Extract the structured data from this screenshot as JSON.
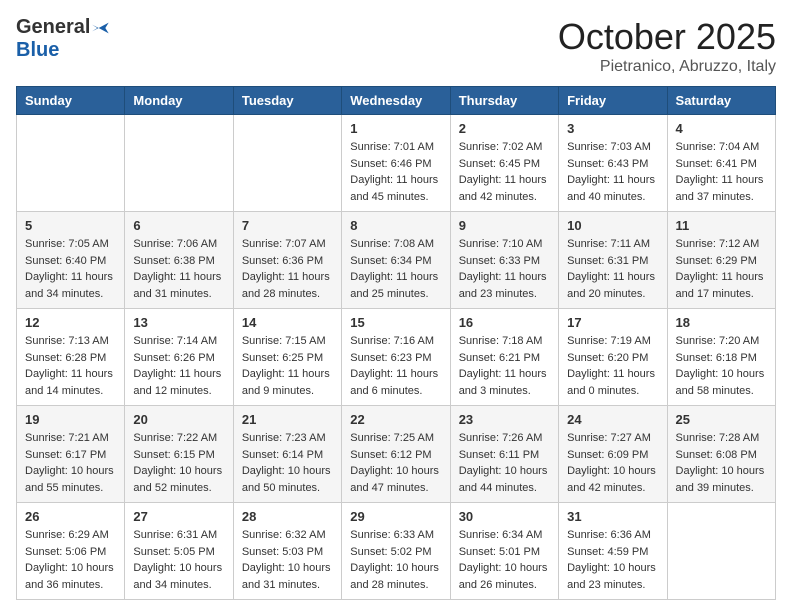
{
  "header": {
    "logo": {
      "general": "General",
      "blue": "Blue",
      "tagline": ""
    },
    "title": "October 2025",
    "location": "Pietranico, Abruzzo, Italy"
  },
  "weekdays": [
    "Sunday",
    "Monday",
    "Tuesday",
    "Wednesday",
    "Thursday",
    "Friday",
    "Saturday"
  ],
  "weeks": [
    [
      {
        "day": "",
        "sunrise": "",
        "sunset": "",
        "daylight": ""
      },
      {
        "day": "",
        "sunrise": "",
        "sunset": "",
        "daylight": ""
      },
      {
        "day": "",
        "sunrise": "",
        "sunset": "",
        "daylight": ""
      },
      {
        "day": "1",
        "sunrise": "7:01 AM",
        "sunset": "6:46 PM",
        "daylight": "11 hours and 45 minutes."
      },
      {
        "day": "2",
        "sunrise": "7:02 AM",
        "sunset": "6:45 PM",
        "daylight": "11 hours and 42 minutes."
      },
      {
        "day": "3",
        "sunrise": "7:03 AM",
        "sunset": "6:43 PM",
        "daylight": "11 hours and 40 minutes."
      },
      {
        "day": "4",
        "sunrise": "7:04 AM",
        "sunset": "6:41 PM",
        "daylight": "11 hours and 37 minutes."
      }
    ],
    [
      {
        "day": "5",
        "sunrise": "7:05 AM",
        "sunset": "6:40 PM",
        "daylight": "11 hours and 34 minutes."
      },
      {
        "day": "6",
        "sunrise": "7:06 AM",
        "sunset": "6:38 PM",
        "daylight": "11 hours and 31 minutes."
      },
      {
        "day": "7",
        "sunrise": "7:07 AM",
        "sunset": "6:36 PM",
        "daylight": "11 hours and 28 minutes."
      },
      {
        "day": "8",
        "sunrise": "7:08 AM",
        "sunset": "6:34 PM",
        "daylight": "11 hours and 25 minutes."
      },
      {
        "day": "9",
        "sunrise": "7:10 AM",
        "sunset": "6:33 PM",
        "daylight": "11 hours and 23 minutes."
      },
      {
        "day": "10",
        "sunrise": "7:11 AM",
        "sunset": "6:31 PM",
        "daylight": "11 hours and 20 minutes."
      },
      {
        "day": "11",
        "sunrise": "7:12 AM",
        "sunset": "6:29 PM",
        "daylight": "11 hours and 17 minutes."
      }
    ],
    [
      {
        "day": "12",
        "sunrise": "7:13 AM",
        "sunset": "6:28 PM",
        "daylight": "11 hours and 14 minutes."
      },
      {
        "day": "13",
        "sunrise": "7:14 AM",
        "sunset": "6:26 PM",
        "daylight": "11 hours and 12 minutes."
      },
      {
        "day": "14",
        "sunrise": "7:15 AM",
        "sunset": "6:25 PM",
        "daylight": "11 hours and 9 minutes."
      },
      {
        "day": "15",
        "sunrise": "7:16 AM",
        "sunset": "6:23 PM",
        "daylight": "11 hours and 6 minutes."
      },
      {
        "day": "16",
        "sunrise": "7:18 AM",
        "sunset": "6:21 PM",
        "daylight": "11 hours and 3 minutes."
      },
      {
        "day": "17",
        "sunrise": "7:19 AM",
        "sunset": "6:20 PM",
        "daylight": "11 hours and 0 minutes."
      },
      {
        "day": "18",
        "sunrise": "7:20 AM",
        "sunset": "6:18 PM",
        "daylight": "10 hours and 58 minutes."
      }
    ],
    [
      {
        "day": "19",
        "sunrise": "7:21 AM",
        "sunset": "6:17 PM",
        "daylight": "10 hours and 55 minutes."
      },
      {
        "day": "20",
        "sunrise": "7:22 AM",
        "sunset": "6:15 PM",
        "daylight": "10 hours and 52 minutes."
      },
      {
        "day": "21",
        "sunrise": "7:23 AM",
        "sunset": "6:14 PM",
        "daylight": "10 hours and 50 minutes."
      },
      {
        "day": "22",
        "sunrise": "7:25 AM",
        "sunset": "6:12 PM",
        "daylight": "10 hours and 47 minutes."
      },
      {
        "day": "23",
        "sunrise": "7:26 AM",
        "sunset": "6:11 PM",
        "daylight": "10 hours and 44 minutes."
      },
      {
        "day": "24",
        "sunrise": "7:27 AM",
        "sunset": "6:09 PM",
        "daylight": "10 hours and 42 minutes."
      },
      {
        "day": "25",
        "sunrise": "7:28 AM",
        "sunset": "6:08 PM",
        "daylight": "10 hours and 39 minutes."
      }
    ],
    [
      {
        "day": "26",
        "sunrise": "6:29 AM",
        "sunset": "5:06 PM",
        "daylight": "10 hours and 36 minutes."
      },
      {
        "day": "27",
        "sunrise": "6:31 AM",
        "sunset": "5:05 PM",
        "daylight": "10 hours and 34 minutes."
      },
      {
        "day": "28",
        "sunrise": "6:32 AM",
        "sunset": "5:03 PM",
        "daylight": "10 hours and 31 minutes."
      },
      {
        "day": "29",
        "sunrise": "6:33 AM",
        "sunset": "5:02 PM",
        "daylight": "10 hours and 28 minutes."
      },
      {
        "day": "30",
        "sunrise": "6:34 AM",
        "sunset": "5:01 PM",
        "daylight": "10 hours and 26 minutes."
      },
      {
        "day": "31",
        "sunrise": "6:36 AM",
        "sunset": "4:59 PM",
        "daylight": "10 hours and 23 minutes."
      },
      {
        "day": "",
        "sunrise": "",
        "sunset": "",
        "daylight": ""
      }
    ]
  ],
  "labels": {
    "sunrise": "Sunrise:",
    "sunset": "Sunset:",
    "daylight": "Daylight:"
  }
}
